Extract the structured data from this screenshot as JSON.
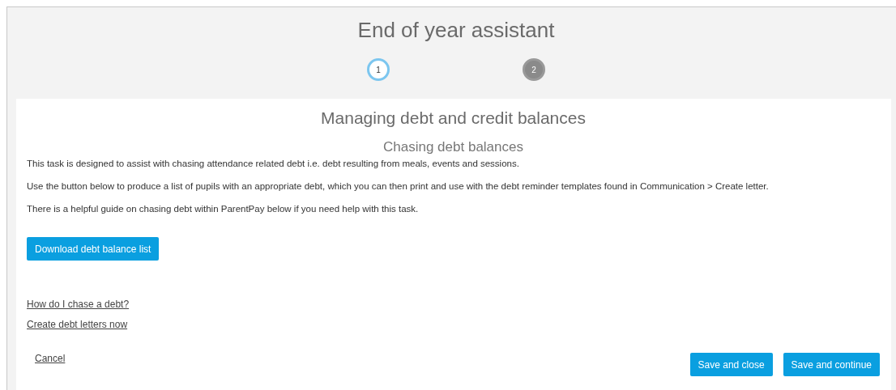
{
  "window": {
    "title": "End of year assistant"
  },
  "steps": [
    {
      "label": "1",
      "selected": true
    },
    {
      "label": "2",
      "selected": false
    }
  ],
  "panel": {
    "heading": "Managing debt and credit balances",
    "subheading": "Chasing debt balances",
    "paragraphs": [
      "This task is designed to assist with chasing attendance related debt i.e. debt resulting from meals, events and sessions.",
      "Use the button below to produce a list of pupils with an appropriate debt, which you can then print and use with the debt reminder templates found in Communication > Create letter.",
      "There is a helpful guide on chasing debt within ParentPay below if you need help with this task."
    ],
    "download_button": "Download debt balance list",
    "links": [
      "How do I chase a debt?",
      "Create debt letters now"
    ]
  },
  "footer": {
    "cancel": "Cancel",
    "buttons": [
      "Save and close",
      "Save and continue"
    ]
  }
}
